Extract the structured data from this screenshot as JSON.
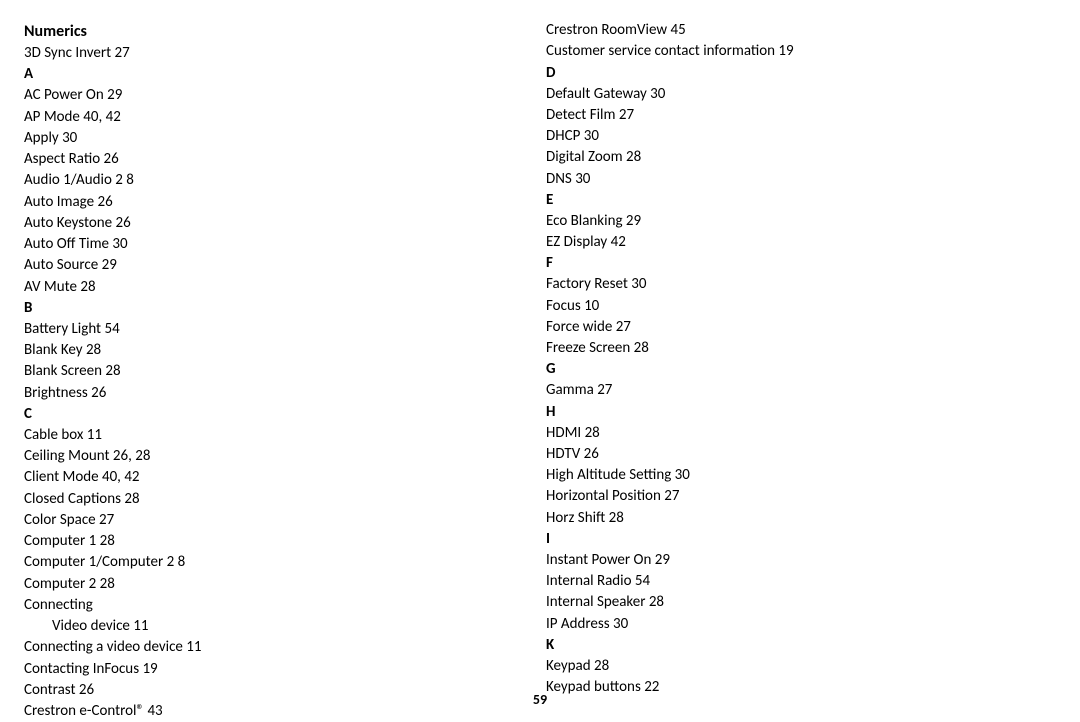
{
  "page_number": "59",
  "left_column": [
    {
      "type": "section",
      "text": "Numerics"
    },
    {
      "type": "entry",
      "text": "3D Sync Invert 27"
    },
    {
      "type": "letter",
      "text": "A"
    },
    {
      "type": "entry",
      "text": "AC Power On 29"
    },
    {
      "type": "entry",
      "text": "AP Mode 40, 42"
    },
    {
      "type": "entry",
      "text": "Apply 30"
    },
    {
      "type": "entry",
      "text": "Aspect Ratio 26"
    },
    {
      "type": "entry",
      "text": "Audio 1/Audio 2 8"
    },
    {
      "type": "entry",
      "text": "Auto Image 26"
    },
    {
      "type": "entry",
      "text": "Auto Keystone 26"
    },
    {
      "type": "entry",
      "text": "Auto Off Time 30"
    },
    {
      "type": "entry",
      "text": "Auto Source 29"
    },
    {
      "type": "entry",
      "text": "AV Mute 28"
    },
    {
      "type": "letter",
      "text": "B"
    },
    {
      "type": "entry",
      "text": "Battery Light 54"
    },
    {
      "type": "entry",
      "text": "Blank Key 28"
    },
    {
      "type": "entry",
      "text": "Blank Screen 28"
    },
    {
      "type": "entry",
      "text": "Brightness 26"
    },
    {
      "type": "letter",
      "text": "C"
    },
    {
      "type": "entry",
      "text": "Cable box 11"
    },
    {
      "type": "entry",
      "text": "Ceiling Mount 26, 28"
    },
    {
      "type": "entry",
      "text": "Client Mode 40, 42"
    },
    {
      "type": "entry",
      "text": "Closed Captions 28"
    },
    {
      "type": "entry",
      "text": "Color Space 27"
    },
    {
      "type": "entry",
      "text": "Computer 1 28"
    },
    {
      "type": "entry",
      "text": "Computer 1/Computer 2 8"
    },
    {
      "type": "entry",
      "text": "Computer 2 28"
    },
    {
      "type": "entry",
      "text": "Connecting"
    },
    {
      "type": "subentry",
      "text": "Video device 11"
    },
    {
      "type": "entry",
      "text": "Connecting a video device 11"
    },
    {
      "type": "entry",
      "text": "Contacting InFocus 19"
    },
    {
      "type": "entry",
      "text": "Contrast 26"
    },
    {
      "type": "entry",
      "text": "Crestron e-Control® 43"
    }
  ],
  "right_column": [
    {
      "type": "entry",
      "text": "Crestron RoomView 45"
    },
    {
      "type": "entry",
      "text": "Customer service contact information 19"
    },
    {
      "type": "letter",
      "text": "D"
    },
    {
      "type": "entry",
      "text": "Default Gateway 30"
    },
    {
      "type": "entry",
      "text": "Detect Film 27"
    },
    {
      "type": "entry",
      "text": "DHCP 30"
    },
    {
      "type": "entry",
      "text": "Digital Zoom 28"
    },
    {
      "type": "entry",
      "text": "DNS 30"
    },
    {
      "type": "letter",
      "text": "E"
    },
    {
      "type": "entry",
      "text": "Eco Blanking 29"
    },
    {
      "type": "entry",
      "text": "EZ Display 42"
    },
    {
      "type": "letter",
      "text": "F"
    },
    {
      "type": "entry",
      "text": "Factory Reset 30"
    },
    {
      "type": "entry",
      "text": "Focus 10"
    },
    {
      "type": "entry",
      "text": "Force wide 27"
    },
    {
      "type": "entry",
      "text": "Freeze Screen 28"
    },
    {
      "type": "letter",
      "text": "G"
    },
    {
      "type": "entry",
      "text": "Gamma 27"
    },
    {
      "type": "letter",
      "text": "H"
    },
    {
      "type": "entry",
      "text": "HDMI 28"
    },
    {
      "type": "entry",
      "text": "HDTV 26"
    },
    {
      "type": "entry",
      "text": "High Altitude Setting 30"
    },
    {
      "type": "entry",
      "text": "Horizontal Position 27"
    },
    {
      "type": "entry",
      "text": "Horz Shift 28"
    },
    {
      "type": "letter",
      "text": "I"
    },
    {
      "type": "entry",
      "text": "Instant Power On 29"
    },
    {
      "type": "entry",
      "text": "Internal Radio 54"
    },
    {
      "type": "entry",
      "text": "Internal Speaker 28"
    },
    {
      "type": "entry",
      "text": "IP Address 30"
    },
    {
      "type": "letter",
      "text": "K"
    },
    {
      "type": "entry",
      "text": "Keypad 28"
    },
    {
      "type": "entry",
      "text": "Keypad buttons 22"
    }
  ]
}
